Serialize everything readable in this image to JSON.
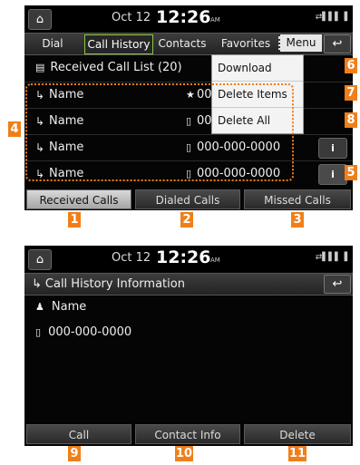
{
  "screen1": {
    "status": {
      "date": "Oct 12",
      "time": "12:26",
      "ampm": "AM",
      "icons": "⇄▌▌▌▐"
    },
    "tabs": [
      "Dial",
      "Call History",
      "Contacts",
      "Favorites"
    ],
    "menu_label": "Menu",
    "list_title": "Received Call List (20)",
    "rows": [
      {
        "name": "Name",
        "number": "000-000-0000"
      },
      {
        "name": "Name",
        "number": "000-000-0000"
      },
      {
        "name": "Name",
        "number": "000-000-0000"
      },
      {
        "name": "Name",
        "number": "000-000-0000"
      }
    ],
    "dropdown": [
      "Download",
      "Delete Items",
      "Delete All"
    ],
    "bottom_buttons": [
      "Received Calls",
      "Dialed Calls",
      "Missed Calls"
    ]
  },
  "screen2": {
    "status": {
      "date": "Oct 12",
      "time": "12:26",
      "ampm": "AM",
      "icons": "⇄▌▌▌▐"
    },
    "title": "Call History Information",
    "name": "Name",
    "number": "000-000-0000",
    "bottom_buttons": [
      "Call",
      "Contact Info",
      "Delete"
    ]
  },
  "callouts": [
    "1",
    "2",
    "3",
    "4",
    "5",
    "6",
    "7",
    "8",
    "9",
    "10",
    "11"
  ],
  "colors": {
    "accent": "#f07f1a",
    "tab_highlight": "#8ec73d"
  }
}
